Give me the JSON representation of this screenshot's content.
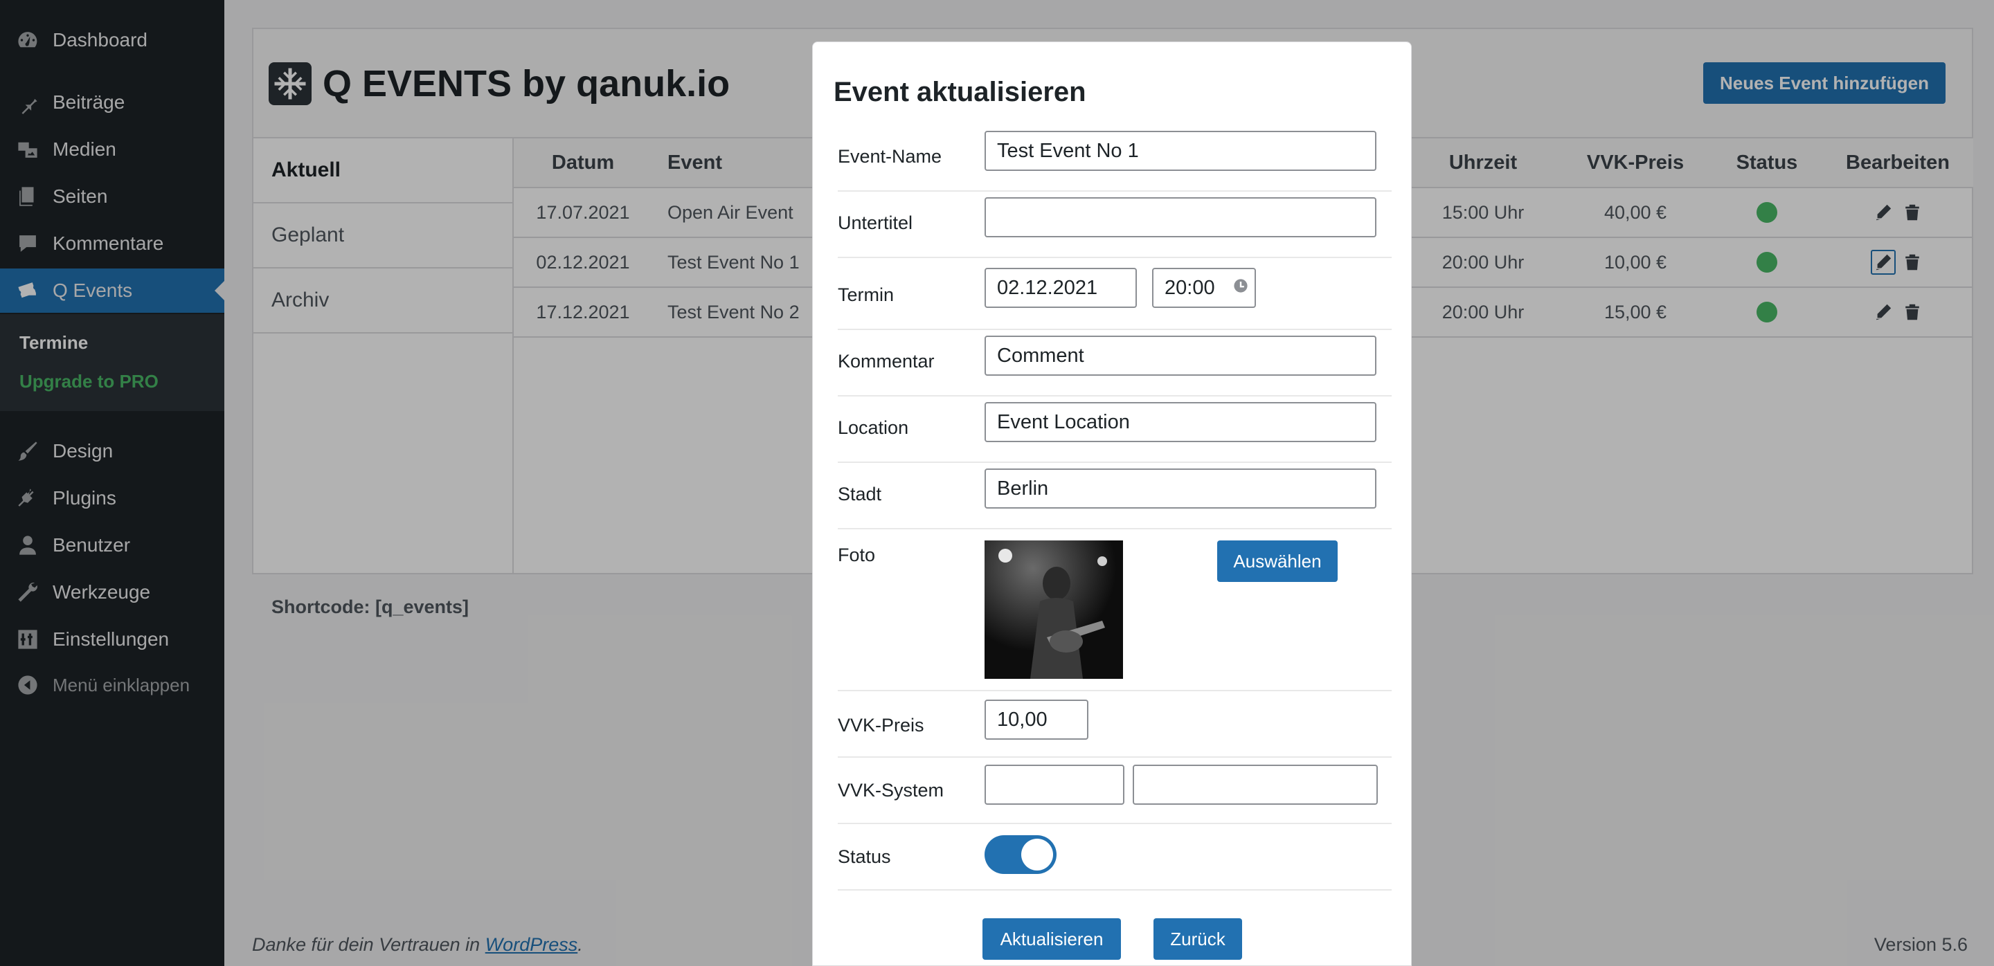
{
  "sidebar": {
    "items": [
      {
        "label": "Dashboard",
        "icon": "dashboard-icon"
      },
      {
        "label": "Beiträge",
        "icon": "pin-icon"
      },
      {
        "label": "Medien",
        "icon": "media-icon"
      },
      {
        "label": "Seiten",
        "icon": "pages-icon"
      },
      {
        "label": "Kommentare",
        "icon": "comment-icon"
      },
      {
        "label": "Q Events",
        "icon": "tickets-icon"
      },
      {
        "label": "Design",
        "icon": "brush-icon"
      },
      {
        "label": "Plugins",
        "icon": "plugin-icon"
      },
      {
        "label": "Benutzer",
        "icon": "user-icon"
      },
      {
        "label": "Werkzeuge",
        "icon": "wrench-icon"
      },
      {
        "label": "Einstellungen",
        "icon": "settings-icon"
      }
    ],
    "submenu": {
      "current": "Termine",
      "pro": "Upgrade to PRO"
    },
    "collapse_label": "Menü einklappen"
  },
  "header": {
    "title": "Q EVENTS by qanuk.io",
    "add_button": "Neues Event hinzufügen"
  },
  "tabs": [
    "Aktuell",
    "Geplant",
    "Archiv"
  ],
  "table": {
    "columns": {
      "datum": "Datum",
      "event": "Event",
      "uhrzeit": "Uhrzeit",
      "preis": "VVK-Preis",
      "status": "Status",
      "edit": "Bearbeiten"
    },
    "rows": [
      {
        "datum": "17.07.2021",
        "event": "Open Air Event",
        "uhrzeit": "15:00 Uhr",
        "preis": "40,00 €"
      },
      {
        "datum": "02.12.2021",
        "event": "Test Event No 1",
        "uhrzeit": "20:00 Uhr",
        "preis": "10,00 €"
      },
      {
        "datum": "17.12.2021",
        "event": "Test Event No 2",
        "uhrzeit": "20:00 Uhr",
        "preis": "15,00 €"
      }
    ]
  },
  "shortcode": "Shortcode: [q_events]",
  "footer": {
    "prefix": "Danke für dein Vertrauen in ",
    "link": "WordPress",
    "suffix": ".",
    "version": "Version 5.6"
  },
  "modal": {
    "title": "Event aktualisieren",
    "labels": {
      "name": "Event-Name",
      "subtitle": "Untertitel",
      "termin": "Termin",
      "comment": "Kommentar",
      "location": "Location",
      "city": "Stadt",
      "photo": "Foto",
      "price": "VVK-Preis",
      "system": "VVK-System",
      "status": "Status"
    },
    "values": {
      "name": "Test Event No 1",
      "subtitle": "",
      "date": "02.12.2021",
      "time": "20:00",
      "comment": "Comment",
      "location": "Event Location",
      "city": "Berlin",
      "price": "10,00",
      "system_a": "",
      "system_b": ""
    },
    "status_on": true,
    "choose_button": "Auswählen",
    "update_button": "Aktualisieren",
    "back_button": "Zurück"
  },
  "colors": {
    "accent": "#2271b1",
    "sidebar": "#1d2327",
    "status_active": "#4ab866"
  }
}
